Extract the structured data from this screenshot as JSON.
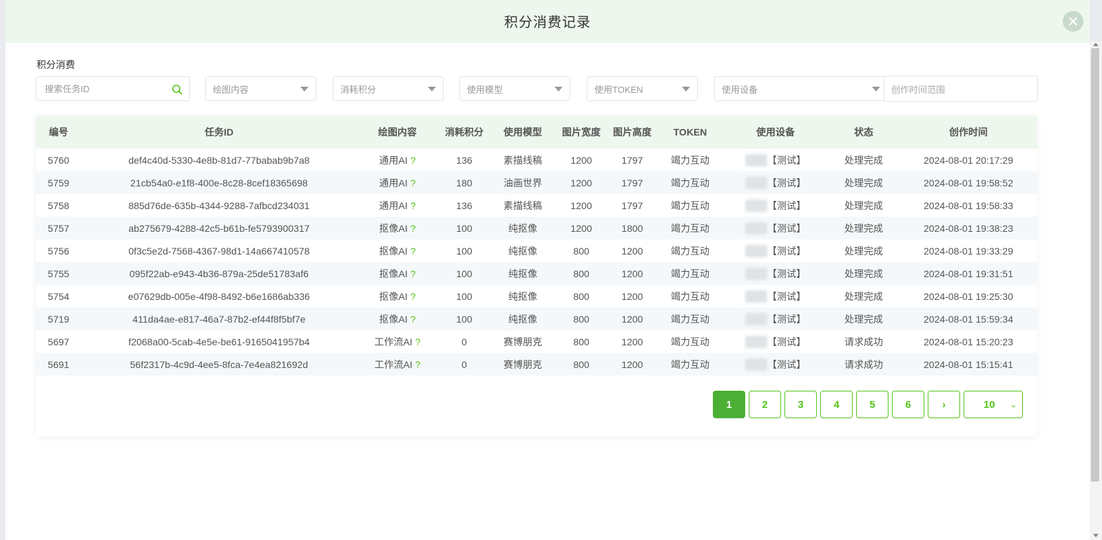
{
  "modal": {
    "title": "积分消费记录"
  },
  "section_label": "积分消费",
  "filters": {
    "task_id_placeholder": "搜索任务ID",
    "content_placeholder": "绘图内容",
    "points_placeholder": "消耗积分",
    "model_placeholder": "使用模型",
    "token_placeholder": "使用TOKEN",
    "device_placeholder": "使用设备",
    "date_placeholder": "创作时间范围"
  },
  "table": {
    "columns": [
      "编号",
      "任务ID",
      "绘图内容",
      "消耗积分",
      "使用模型",
      "图片宽度",
      "图片高度",
      "TOKEN",
      "使用设备",
      "状态",
      "创作时间"
    ],
    "rows": [
      {
        "id": "5760",
        "task_id": "def4c40d-5330-4e8b-81d7-77babab9b7a8",
        "content": "通用AI",
        "points": "136",
        "model": "素描线稿",
        "width": "1200",
        "height": "1797",
        "token": "竭力互动",
        "device": "【测试】",
        "status": "处理完成",
        "time": "2024-08-01 20:17:29"
      },
      {
        "id": "5759",
        "task_id": "21cb54a0-e1f8-400e-8c28-8cef18365698",
        "content": "通用AI",
        "points": "180",
        "model": "油画世界",
        "width": "1200",
        "height": "1797",
        "token": "竭力互动",
        "device": "【测试】",
        "status": "处理完成",
        "time": "2024-08-01 19:58:52"
      },
      {
        "id": "5758",
        "task_id": "885d76de-635b-4344-9288-7afbcd234031",
        "content": "通用AI",
        "points": "136",
        "model": "素描线稿",
        "width": "1200",
        "height": "1797",
        "token": "竭力互动",
        "device": "【测试】",
        "status": "处理完成",
        "time": "2024-08-01 19:58:33"
      },
      {
        "id": "5757",
        "task_id": "ab275679-4288-42c5-b61b-fe5793900317",
        "content": "抠像AI",
        "points": "100",
        "model": "纯抠像",
        "width": "1200",
        "height": "1800",
        "token": "竭力互动",
        "device": "【测试】",
        "status": "处理完成",
        "time": "2024-08-01 19:38:23"
      },
      {
        "id": "5756",
        "task_id": "0f3c5e2d-7568-4367-98d1-14a667410578",
        "content": "抠像AI",
        "points": "100",
        "model": "纯抠像",
        "width": "800",
        "height": "1200",
        "token": "竭力互动",
        "device": "【测试】",
        "status": "处理完成",
        "time": "2024-08-01 19:33:29"
      },
      {
        "id": "5755",
        "task_id": "095f22ab-e943-4b36-879a-25de51783af6",
        "content": "抠像AI",
        "points": "100",
        "model": "纯抠像",
        "width": "800",
        "height": "1200",
        "token": "竭力互动",
        "device": "【测试】",
        "status": "处理完成",
        "time": "2024-08-01 19:31:51"
      },
      {
        "id": "5754",
        "task_id": "e07629db-005e-4f98-8492-b6e1686ab336",
        "content": "抠像AI",
        "points": "100",
        "model": "纯抠像",
        "width": "800",
        "height": "1200",
        "token": "竭力互动",
        "device": "【测试】",
        "status": "处理完成",
        "time": "2024-08-01 19:25:30"
      },
      {
        "id": "5719",
        "task_id": "411da4ae-e817-46a7-87b2-ef44f8f5bf7e",
        "content": "抠像AI",
        "points": "100",
        "model": "纯抠像",
        "width": "800",
        "height": "1200",
        "token": "竭力互动",
        "device": "【测试】",
        "status": "处理完成",
        "time": "2024-08-01 15:59:34"
      },
      {
        "id": "5697",
        "task_id": "f2068a00-5cab-4e5e-be61-9165041957b4",
        "content": "工作流AI",
        "points": "0",
        "model": "赛博朋克",
        "width": "800",
        "height": "1200",
        "token": "竭力互动",
        "device": "【测试】",
        "status": "请求成功",
        "time": "2024-08-01 15:20:23"
      },
      {
        "id": "5691",
        "task_id": "56f2317b-4c9d-4ee5-8fca-7e4ea821692d",
        "content": "工作流AI",
        "points": "0",
        "model": "赛博朋克",
        "width": "800",
        "height": "1200",
        "token": "竭力互动",
        "device": "【测试】",
        "status": "请求成功",
        "time": "2024-08-01 15:15:41"
      }
    ]
  },
  "pagination": {
    "pages": [
      "1",
      "2",
      "3",
      "4",
      "5",
      "6"
    ],
    "current": "1",
    "next": "›",
    "page_size": "10"
  },
  "colors": {
    "accent": "#52c41a",
    "header_bg": "#eef7ee"
  }
}
